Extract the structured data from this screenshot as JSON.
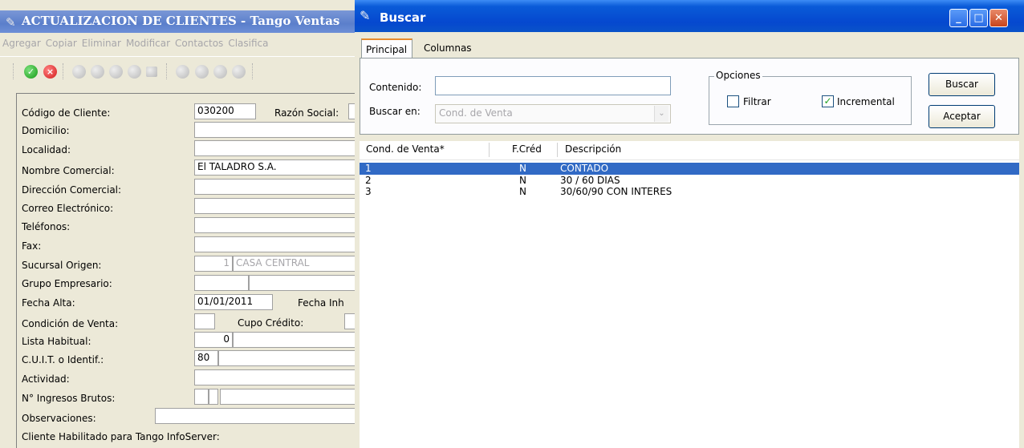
{
  "main_window": {
    "title": "ACTUALIZACION DE CLIENTES - Tango Ventas",
    "menu": [
      "Agregar",
      "Copiar",
      "Eliminar",
      "Modificar",
      "Contactos",
      "Clasifica"
    ],
    "fields": {
      "codigo_cliente": {
        "label": "Código de Cliente:",
        "value": "030200"
      },
      "razon_social": {
        "label": "Razón Social:"
      },
      "domicilio": {
        "label": "Domicilio:"
      },
      "localidad": {
        "label": "Localidad:"
      },
      "nombre_comercial": {
        "label": "Nombre Comercial:",
        "value": "El TALADRO S.A."
      },
      "direccion_comercial": {
        "label": "Dirección Comercial:"
      },
      "correo": {
        "label": "Correo Electrónico:"
      },
      "telefonos": {
        "label": "Teléfonos:"
      },
      "fax": {
        "label": "Fax:"
      },
      "sucursal_origen": {
        "label": "Sucursal Origen:",
        "code": "1",
        "name": "CASA CENTRAL"
      },
      "grupo_empresario": {
        "label": "Grupo Empresario:"
      },
      "fecha_alta": {
        "label": "Fecha Alta:",
        "value": "01/01/2011"
      },
      "fecha_inh": {
        "label": "Fecha Inh"
      },
      "condicion_venta": {
        "label": "Condición de Venta:"
      },
      "cupo_credito": {
        "label": "Cupo Crédito:"
      },
      "lista_habitual": {
        "label": "Lista Habitual:",
        "value": "0"
      },
      "cuit": {
        "label": "C.U.I.T. o Identif.:",
        "value": "80"
      },
      "actividad": {
        "label": "Actividad:"
      },
      "ingresos_brutos": {
        "label": "N° Ingresos Brutos:"
      },
      "observaciones": {
        "label": "Observaciones:"
      },
      "infoserver": {
        "label": "Cliente Habilitado para Tango InfoServer:"
      }
    }
  },
  "dialog": {
    "title": "Buscar",
    "tabs": [
      "Principal",
      "Columnas"
    ],
    "contenido_label": "Contenido:",
    "contenido_value": "",
    "buscar_en_label": "Buscar en:",
    "buscar_en_value": "Cond. de Venta",
    "opciones_title": "Opciones",
    "filtrar_label": "Filtrar",
    "filtrar_checked": false,
    "incremental_label": "Incremental",
    "incremental_checked": true,
    "buscar_button": "Buscar",
    "aceptar_button": "Aceptar",
    "columns": [
      "Cond. de Venta*",
      "F.Créd",
      "Descripción"
    ],
    "rows": [
      {
        "cond": "1",
        "fcred": "N",
        "desc": "CONTADO",
        "selected": true
      },
      {
        "cond": "2",
        "fcred": "N",
        "desc": "30 / 60 DIAS",
        "selected": false
      },
      {
        "cond": "3",
        "fcred": "N",
        "desc": "30/60/90 CON INTERES",
        "selected": false
      }
    ]
  },
  "colors": {
    "xp_title_blue": "#0548cf",
    "inactive_title": "#5b7fcb",
    "selection": "#316ac5",
    "window_face": "#ece9d8"
  }
}
